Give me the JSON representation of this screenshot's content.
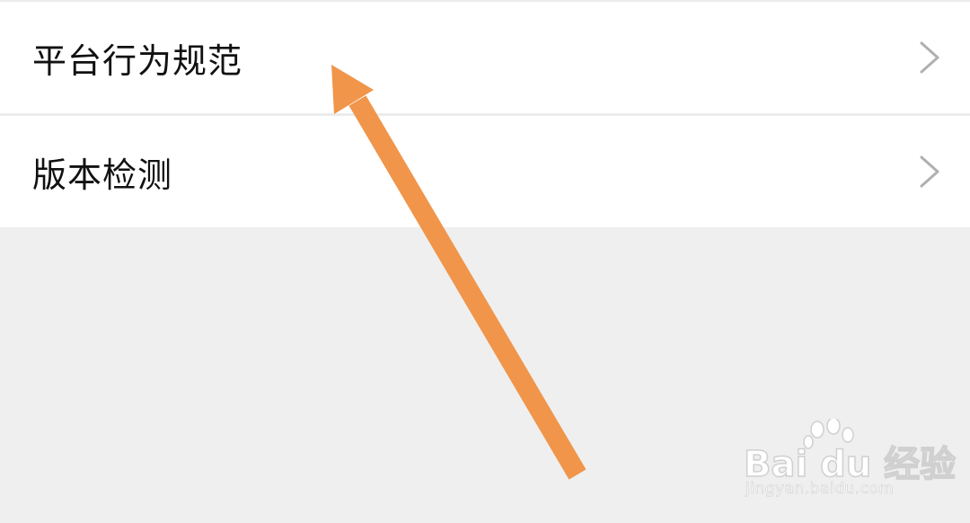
{
  "settings": {
    "items": [
      {
        "label": "平台行为规范",
        "icon": "chevron-right-icon"
      },
      {
        "label": "版本检测",
        "icon": "chevron-right-icon"
      }
    ]
  },
  "watermark": {
    "brand": "Bai du 经验",
    "url": "jingyan.baidu.com"
  },
  "colors": {
    "background": "#efefef",
    "row": "#ffffff",
    "divider": "#ececec",
    "text": "#111111",
    "chevron": "#b0b0b0",
    "arrow": "#f0954a"
  }
}
